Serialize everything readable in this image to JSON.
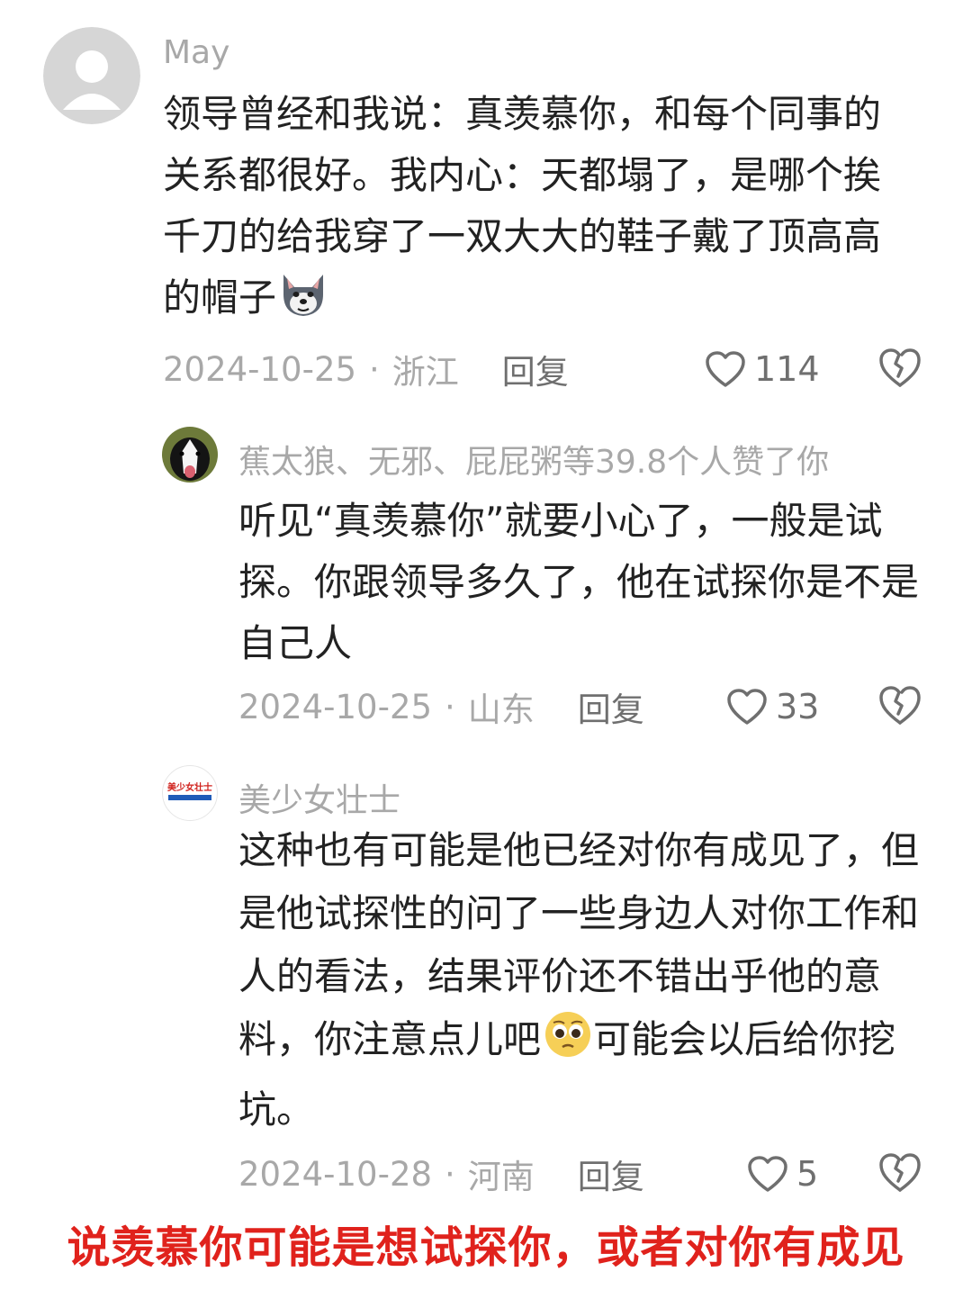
{
  "comments": [
    {
      "username": "May",
      "text": "领导曾经和我说：真羡慕你，和每个同事的关系都很好。我内心：天都塌了，是哪个挨千刀的给我穿了一双大大的鞋子戴了顶高高的帽子",
      "emoji": "wolf-emoji",
      "date": "2024-10-25",
      "separator": "·",
      "location": "浙江",
      "reply": "回复",
      "likes": "114"
    },
    {
      "username": "蕉太狼、无邪、屁屁粥等39.8个人赞了你",
      "text": "听见“真羡慕你”就要小心了，一般是试探。你跟领导多久了，他在试探你是不是自己人",
      "date": "2024-10-25",
      "separator": "·",
      "location": "山东",
      "reply": "回复",
      "likes": "33"
    },
    {
      "username": "美少女壮士",
      "avatar_text": "美少女壮士",
      "text_before": "这种也有可能是他已经对你有成见了，但是他试探性的问了一些身边人对你工作和人的看法，结果评价还不错出乎他的意料，你注意点儿吧",
      "emoji": "pleading-face-emoji",
      "text_after": "可能会以后给你挖坑。",
      "date": "2024-10-28",
      "separator": "·",
      "location": "河南",
      "reply": "回复",
      "likes": "5"
    }
  ],
  "caption": "说羡慕你可能是想试探你，或者对你有成见",
  "colors": {
    "caption": "#e0221c",
    "meta": "#a8a8a8",
    "text": "#222222"
  }
}
